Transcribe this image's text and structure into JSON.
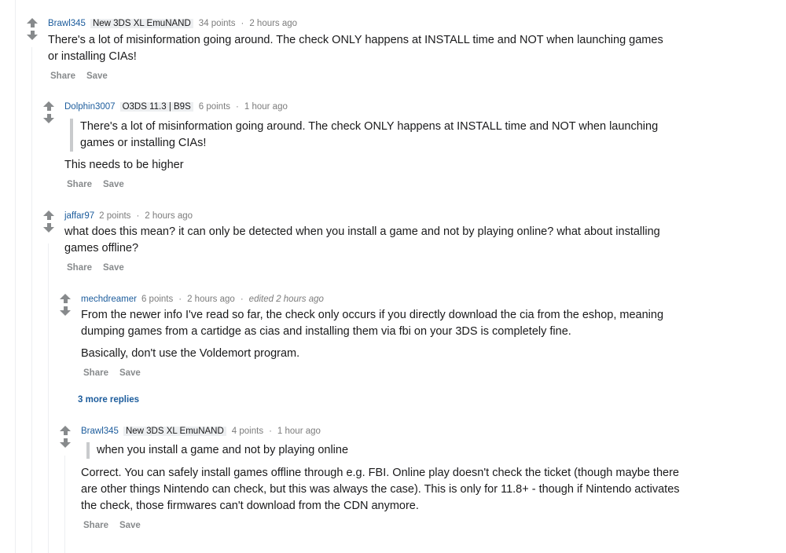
{
  "actions": {
    "share": "Share",
    "save": "Save"
  },
  "comments": [
    {
      "author": "Brawl345",
      "flair": "New 3DS XL EmuNAND",
      "points": "34 points",
      "time": "2 hours ago",
      "line1": "There's a lot of misinformation going around. The check ONLY happens at INSTALL time and NOT when launching games",
      "line2": "or installing CIAs!"
    },
    {
      "author": "Dolphin3007",
      "flair": "O3DS 11.3 | B9S",
      "points": "6 points",
      "time": "1 hour ago",
      "quote1": "There's a lot of misinformation going around. The check ONLY happens at INSTALL time and NOT when launching",
      "quote2": "games or installing CIAs!",
      "line1": "This needs to be higher"
    },
    {
      "author": "jaffar97",
      "points": "2 points",
      "time": "2 hours ago",
      "line1": "what does this mean? it can only be detected when you install a game and not by playing online? what about installing",
      "line2": "games offline?"
    },
    {
      "author": "mechdreamer",
      "points": "6 points",
      "time": "2 hours ago",
      "edited": "edited 2 hours ago",
      "line1": "From the newer info I've read so far, the check only occurs if you directly download the cia from the eshop, meaning",
      "line2": "dumping games from a cartidge as cias and installing them via fbi on your 3DS is completely fine.",
      "line3": "Basically, don't use the Voldemort program.",
      "more_replies": "3 more replies"
    },
    {
      "author": "Brawl345",
      "flair": "New 3DS XL EmuNAND",
      "points": "4 points",
      "time": "1 hour ago",
      "quote1": "when you install a game and not by playing online",
      "line1": "Correct. You can safely install games offline through e.g. FBI. Online play doesn't check the ticket (though maybe there",
      "line2": "are other things Nintendo can check, but this was always the case). This is only for 11.8+ - though if Nintendo activates",
      "line3": "the check, those firmwares can't download from the CDN anymore."
    }
  ]
}
